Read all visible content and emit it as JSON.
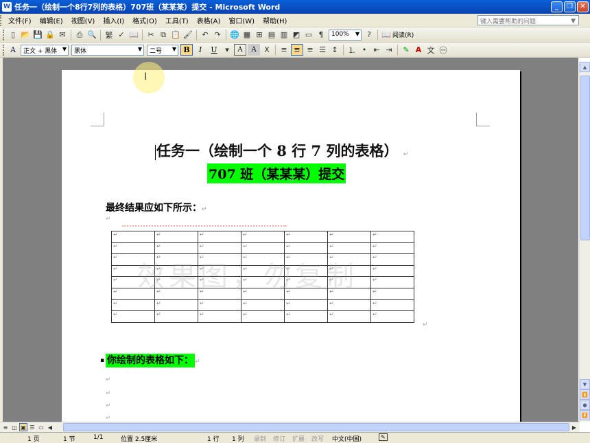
{
  "titlebar": {
    "title": "任务一（绘制一个8行7列的表格）707班（某某某）提交 - Microsoft Word",
    "app_icon": "W"
  },
  "window_buttons": {
    "minimize": "_",
    "restore": "❐",
    "close": "✕"
  },
  "menu": [
    "文件(F)",
    "编辑(E)",
    "视图(V)",
    "插入(I)",
    "格式(O)",
    "工具(T)",
    "表格(A)",
    "窗口(W)",
    "帮助(H)"
  ],
  "help_box": {
    "placeholder": "键入需要帮助的问题"
  },
  "toolbar": {
    "zoom": "100%",
    "reading": "阅读(R)"
  },
  "format_bar": {
    "style": "正文 + 黑体",
    "font": "黑体",
    "size": "二号",
    "bold": "B",
    "italic": "I",
    "underline": "U"
  },
  "document": {
    "title_line1": "任务一（绘制一个 8 行 7 列的表格）",
    "title_line2": "707 班（某某某）提交",
    "subtitle": "最终结果应如下所示：",
    "watermark": "效果图，勿复制",
    "your_table": "你绘制的表格如下：",
    "para_mark": "↵",
    "table": {
      "rows": 8,
      "cols": 7
    }
  },
  "statusbar": {
    "page": "1 页",
    "section": "1 节",
    "page_of": "1/1",
    "position": "位置 2.5厘米",
    "line": "1 行",
    "col": "1 列",
    "rec": "录制",
    "trk": "修订",
    "ext": "扩展",
    "ovr": "改写",
    "lang": "中文(中国)"
  }
}
